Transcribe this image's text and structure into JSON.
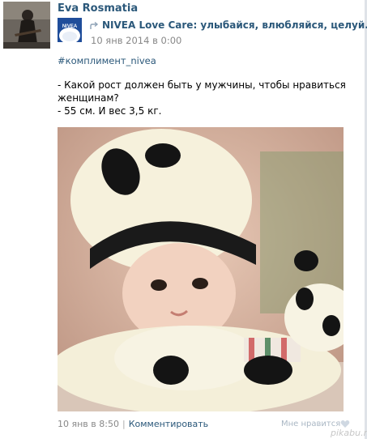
{
  "post": {
    "author": "Eva Rosmatia",
    "repost": {
      "source_name": "NIVEA Love Care: улыбайся, влюбляйся, целуй...",
      "date": "10 янв 2014 в 0:00"
    },
    "hashtag": "#комплимент_nivea",
    "text_lines": [
      "- Какой рост должен быть у мужчины, чтобы нравиться",
      "женщинам?",
      "- 55 см. И вес 3,5 кг."
    ],
    "footer": {
      "date": "10 янв в 8:50",
      "separator": "|",
      "comment_label": "Комментировать",
      "like_label": "Мне нравится"
    }
  },
  "logo_text": "NIVEA",
  "watermark": "pikabu.ru",
  "colors": {
    "link": "#2b587a",
    "meta": "#888888",
    "like": "#aab7c4",
    "brand": "#1f4d9a"
  }
}
